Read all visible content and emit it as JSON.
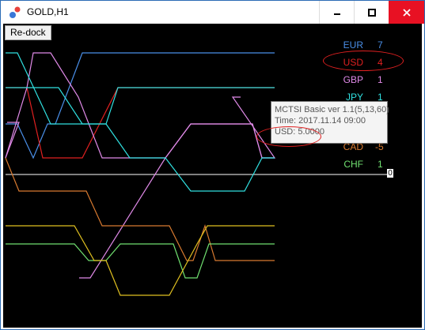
{
  "window": {
    "title": "GOLD,H1"
  },
  "controls": {
    "minimize": "▁",
    "maximize": "▢",
    "close": "✕"
  },
  "toolbar": {
    "redock_label": "Re-dock"
  },
  "legend": [
    {
      "code": "EUR",
      "value": "7",
      "color": "#4a8fe8"
    },
    {
      "code": "USD",
      "value": "4",
      "color": "#e02020"
    },
    {
      "code": "GBP",
      "value": "1",
      "color": "#e08ae8"
    },
    {
      "code": "JPY",
      "value": "1",
      "color": "#30e0e0"
    },
    {
      "code": "CAD",
      "value": "-5",
      "color": "#d87a30"
    },
    {
      "code": "CHF",
      "value": "1",
      "color": "#70e070"
    }
  ],
  "zero_label": "0",
  "tooltip": {
    "line1": "MCTSI Basic ver 1.1(5,13,60)",
    "line2": "Time: 2017.11.14 09:00",
    "line3": "USD: 5.0000"
  }
}
